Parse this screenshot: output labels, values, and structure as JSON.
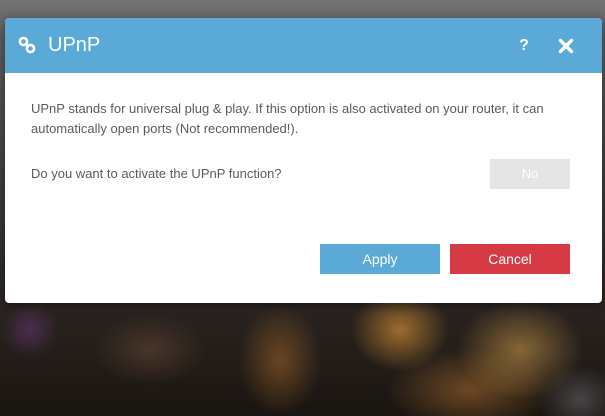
{
  "dialog": {
    "title": "UPnP",
    "title_icon": "link-icon",
    "help_label": "?",
    "close_icon": "close-icon",
    "description": "UPnP stands for universal plug & play. If this option is also activated on your router, it can automatically open ports (Not recommended!).",
    "question": "Do you want to activate the UPnP function?",
    "toggle_value": "No",
    "apply_label": "Apply",
    "cancel_label": "Cancel"
  },
  "colors": {
    "titlebar": "#5aa9d6",
    "apply": "#5aa9d6",
    "cancel": "#d63b45",
    "toggle_off": "#e5e5e5",
    "text": "#5a5a5a"
  }
}
